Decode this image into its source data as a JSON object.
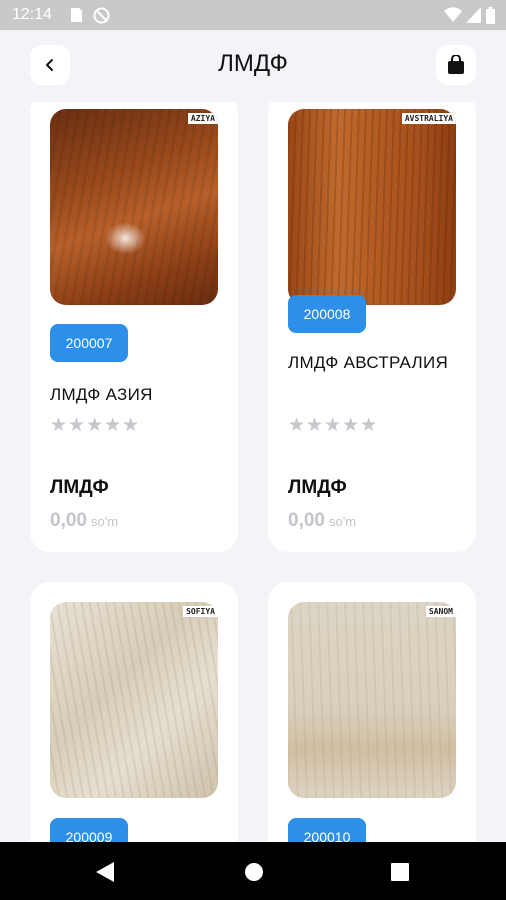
{
  "status_bar": {
    "time": "12:14"
  },
  "header": {
    "title": "ЛМДФ",
    "back_icon": "chevron-left-icon",
    "cart_icon": "shopping-bag-icon"
  },
  "products": [
    {
      "texture_label": "AZIYA",
      "code": "200007",
      "name": "ЛМДФ АЗИЯ",
      "stars": "★★★★★",
      "category": "ЛМДФ",
      "price": "0,00",
      "currency": "so'm"
    },
    {
      "texture_label": "AVSTRALIYA",
      "code": "200008",
      "name": "ЛМДФ АВСТРАЛИЯ",
      "stars": "★★★★★",
      "category": "ЛМДФ",
      "price": "0,00",
      "currency": "so'm"
    },
    {
      "texture_label": "SOFIYA",
      "code": "200009"
    },
    {
      "texture_label": "SANOM",
      "code": "200010"
    }
  ],
  "colors": {
    "accent": "#2d8fe8",
    "background": "#f4f4f8",
    "muted": "#c4c4cc"
  }
}
